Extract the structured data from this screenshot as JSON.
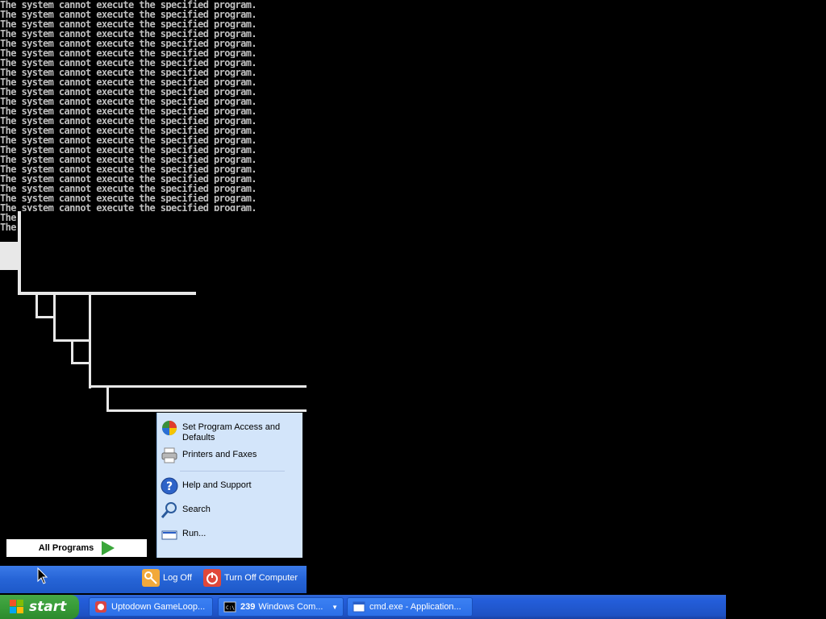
{
  "console": {
    "line_text": "The system cannot execute the specified program.",
    "partial_text": "The",
    "cursor_char": "_"
  },
  "start_menu": {
    "right_items": [
      {
        "label": "Set Program Access and Defaults",
        "icon": "program-access-icon"
      },
      {
        "label": "Printers and Faxes",
        "icon": "printer-icon"
      },
      {
        "label": "Help and Support",
        "icon": "help-icon"
      },
      {
        "label": "Search",
        "icon": "search-icon"
      },
      {
        "label": "Run...",
        "icon": "run-icon"
      }
    ],
    "all_programs": "All Programs",
    "log_off": "Log Off",
    "turn_off": "Turn Off Computer"
  },
  "taskbar": {
    "start_label": "start",
    "buttons": [
      {
        "label": "Uptodown GameLoop..."
      },
      {
        "count": "239",
        "label": "Windows Com..."
      },
      {
        "label": "cmd.exe - Application..."
      }
    ]
  },
  "colors": {
    "taskbar_blue": "#245edb",
    "start_green": "#389c38",
    "menu_pane": "#d3e5fa"
  }
}
